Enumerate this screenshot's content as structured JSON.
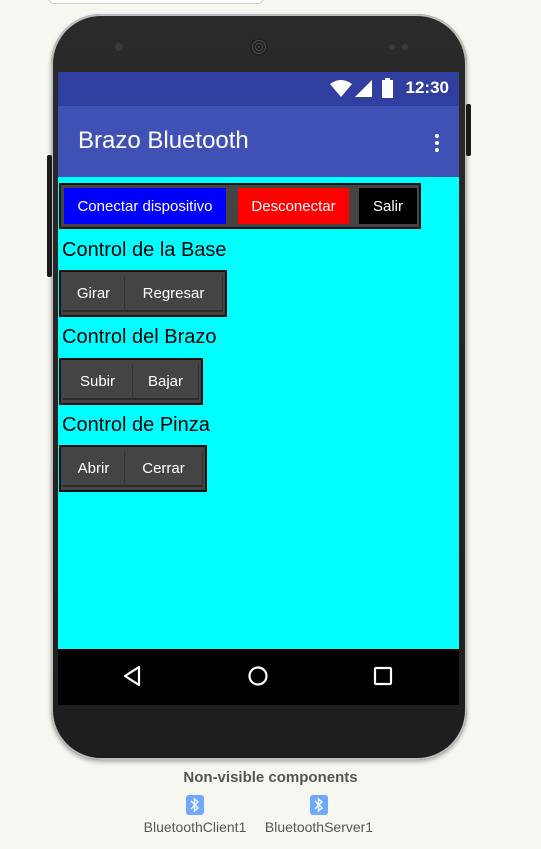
{
  "status_bar": {
    "time": "12:30"
  },
  "app_bar": {
    "title": "Brazo Bluetooth"
  },
  "connection_row": {
    "connect_label": "Conectar dispositivo",
    "disconnect_label": "Desconectar",
    "exit_label": "Salir"
  },
  "base_section": {
    "title": "Control de la Base",
    "rotate_label": "Girar",
    "return_label": "Regresar"
  },
  "arm_section": {
    "title": "Control del Brazo",
    "up_label": "Subir",
    "down_label": "Bajar"
  },
  "gripper_section": {
    "title": "Control de Pinza",
    "open_label": "Abrir",
    "close_label": "Cerrar"
  },
  "nonvisible": {
    "title": "Non-visible components",
    "components": [
      "BluetoothClient1",
      "BluetoothServer1"
    ]
  },
  "colors": {
    "screen_bg": "#00ffff",
    "status_bar": "#303f9f",
    "app_bar": "#3f51b5",
    "connect_button": "#0000ff",
    "disconnect_button": "#ff0000",
    "exit_button": "#000000",
    "control_button": "#444444"
  },
  "icons": [
    "wifi-icon",
    "signal-icon",
    "battery-icon",
    "overflow-menu-icon",
    "back-icon",
    "home-icon",
    "recents-icon",
    "bluetooth-icon"
  ]
}
